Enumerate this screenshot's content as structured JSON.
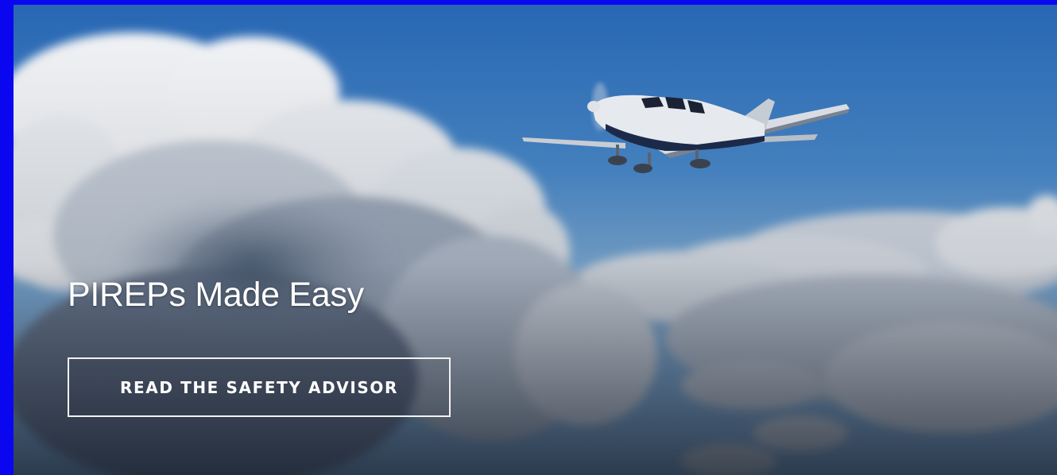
{
  "hero": {
    "heading": "PIREPs Made Easy",
    "cta_label": "READ THE SAFETY ADVISOR",
    "image": "airplane-above-clouds"
  },
  "colors": {
    "frame": "#0a07f0",
    "sky_top": "#2f6fb8",
    "sky_mid": "#6aa6da",
    "cloud": "#f4f6fa",
    "text": "#ffffff"
  }
}
